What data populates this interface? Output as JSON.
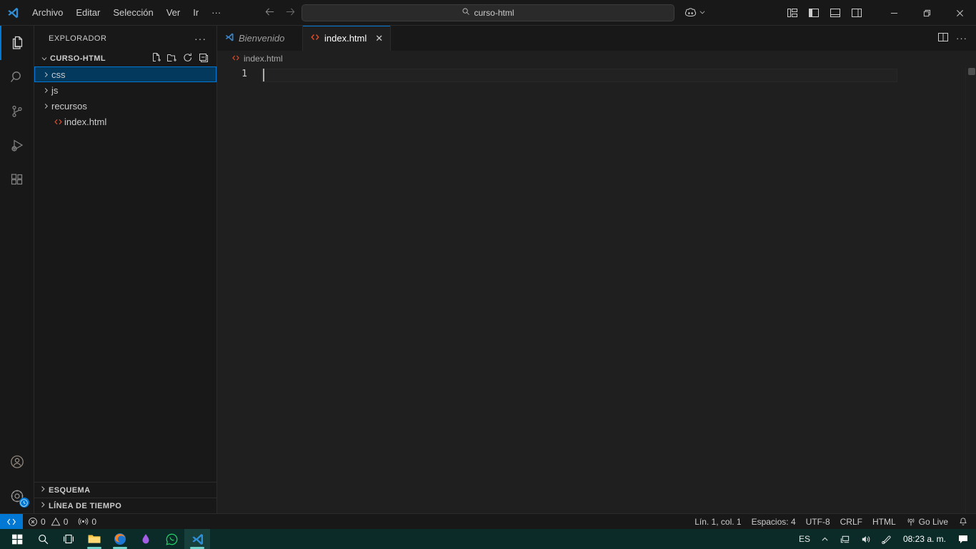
{
  "titlebar": {
    "logo_icon": "vscode-logo-icon",
    "menu": [
      {
        "label": "Archivo",
        "name": "menu-archivo"
      },
      {
        "label": "Editar",
        "name": "menu-editar"
      },
      {
        "label": "Selección",
        "name": "menu-seleccion"
      },
      {
        "label": "Ver",
        "name": "menu-ver"
      },
      {
        "label": "Ir",
        "name": "menu-ir"
      },
      {
        "label": "···",
        "name": "menu-more"
      }
    ],
    "back_icon": "arrow-left-icon",
    "forward_icon": "arrow-right-icon",
    "command_center": {
      "search_icon": "search-icon",
      "text": "curso-html"
    },
    "copilot": {
      "icon": "copilot-icon",
      "chevron": "chevron-down-icon"
    },
    "layout_buttons": [
      {
        "name": "customize-layout-button",
        "icon": "layout-customize-icon"
      },
      {
        "name": "toggle-primary-sidebar-button",
        "icon": "panel-left-icon"
      },
      {
        "name": "toggle-panel-button",
        "icon": "panel-bottom-icon"
      },
      {
        "name": "toggle-secondary-sidebar-button",
        "icon": "panel-right-icon"
      }
    ],
    "window_controls": {
      "minimize": "—",
      "restore": "❐",
      "close": "✕"
    }
  },
  "activitybar": {
    "items": [
      {
        "name": "activity-explorer",
        "icon": "files-icon",
        "active": true
      },
      {
        "name": "activity-search",
        "icon": "search-icon",
        "active": false
      },
      {
        "name": "activity-source-control",
        "icon": "source-control-icon",
        "active": false
      },
      {
        "name": "activity-run-debug",
        "icon": "run-debug-icon",
        "active": false
      },
      {
        "name": "activity-extensions",
        "icon": "extensions-icon",
        "active": false
      }
    ],
    "bottom": [
      {
        "name": "activity-accounts",
        "icon": "account-icon"
      },
      {
        "name": "activity-settings",
        "icon": "gear-icon",
        "badge_icon": "clock-badge-icon"
      }
    ]
  },
  "sidebar": {
    "title": "EXPLORADOR",
    "more_actions": "···",
    "folder": {
      "name": "CURSO-HTML",
      "chevron": "chevron-down-icon",
      "actions": [
        {
          "name": "new-file-button",
          "icon": "new-file-icon"
        },
        {
          "name": "new-folder-button",
          "icon": "new-folder-icon"
        },
        {
          "name": "refresh-explorer-button",
          "icon": "refresh-icon"
        },
        {
          "name": "collapse-folders-button",
          "icon": "collapse-all-icon"
        }
      ]
    },
    "tree": [
      {
        "label": "css",
        "type": "folder",
        "selected": true,
        "icon": "chevron-right-icon"
      },
      {
        "label": "js",
        "type": "folder",
        "selected": false,
        "icon": "chevron-right-icon"
      },
      {
        "label": "recursos",
        "type": "folder",
        "selected": false,
        "icon": "chevron-right-icon"
      },
      {
        "label": "index.html",
        "type": "file",
        "selected": false,
        "icon": "html-file-icon"
      }
    ],
    "sections": [
      {
        "label": "ESQUEMA",
        "name": "section-esquema",
        "chevron": "chevron-right-icon"
      },
      {
        "label": "LÍNEA DE TIEMPO",
        "name": "section-linea-de-tiempo",
        "chevron": "chevron-right-icon"
      }
    ]
  },
  "editor": {
    "tabs": [
      {
        "label": "Bienvenido",
        "icon": "vscode-logo-icon",
        "active": false,
        "closable": false
      },
      {
        "label": "index.html",
        "icon": "html-file-icon",
        "active": true,
        "closable": true,
        "close": "✕"
      }
    ],
    "tab_actions": [
      {
        "name": "split-editor-button",
        "icon": "split-editor-icon"
      },
      {
        "name": "editor-more-actions-button",
        "icon": "ellipsis-icon",
        "label": "···"
      }
    ],
    "breadcrumb": {
      "icon": "html-file-icon",
      "label": "index.html"
    },
    "line_numbers": [
      "1"
    ],
    "content": ""
  },
  "statusbar": {
    "remote": {
      "icon": "remote-indicator-icon",
      "label": ""
    },
    "left": [
      {
        "name": "status-errors",
        "icon": "error-icon",
        "label": "0"
      },
      {
        "name": "status-warnings",
        "icon": "warning-icon",
        "label": "0"
      },
      {
        "name": "status-ports",
        "icon": "ports-icon",
        "label": "0"
      }
    ],
    "right": [
      {
        "name": "status-cursor-position",
        "label": "Lín. 1, col. 1"
      },
      {
        "name": "status-indentation",
        "label": "Espacios: 4"
      },
      {
        "name": "status-encoding",
        "label": "UTF-8"
      },
      {
        "name": "status-eol",
        "label": "CRLF"
      },
      {
        "name": "status-language-mode",
        "label": "HTML"
      },
      {
        "name": "status-go-live",
        "label": "Go Live",
        "icon": "broadcast-icon"
      },
      {
        "name": "status-notifications",
        "label": "",
        "icon": "bell-icon"
      }
    ]
  },
  "taskbar": {
    "apps": [
      {
        "name": "taskbar-start-button",
        "icon": "windows-logo-icon",
        "active": false
      },
      {
        "name": "taskbar-search-button",
        "icon": "search-icon",
        "active": false
      },
      {
        "name": "taskbar-task-view-button",
        "icon": "task-view-icon",
        "active": false
      },
      {
        "name": "taskbar-file-explorer",
        "icon": "file-explorer-icon",
        "active": false,
        "running": true
      },
      {
        "name": "taskbar-firefox",
        "icon": "firefox-icon",
        "active": false,
        "running": true
      },
      {
        "name": "taskbar-app-purple",
        "icon": "purple-app-icon",
        "active": false,
        "running": false
      },
      {
        "name": "taskbar-whatsapp",
        "icon": "whatsapp-icon",
        "active": false,
        "running": false
      },
      {
        "name": "taskbar-vscode",
        "icon": "vscode-logo-icon",
        "active": true,
        "running": true
      }
    ],
    "tray": {
      "language": "ES",
      "chevron": "chevron-up-icon",
      "network_icon": "network-icon",
      "volume_icon": "volume-icon",
      "pen_icon": "pen-icon",
      "clock": "08:23 a. m.",
      "notifications_icon": "notification-icon"
    }
  },
  "colors": {
    "accent": "#0078d4",
    "selection_bg": "#04395e",
    "html_orange": "#e44d26",
    "editor_bg": "#1f1f1f",
    "chrome_bg": "#181818",
    "taskbar_bg": "#0b2b29"
  }
}
